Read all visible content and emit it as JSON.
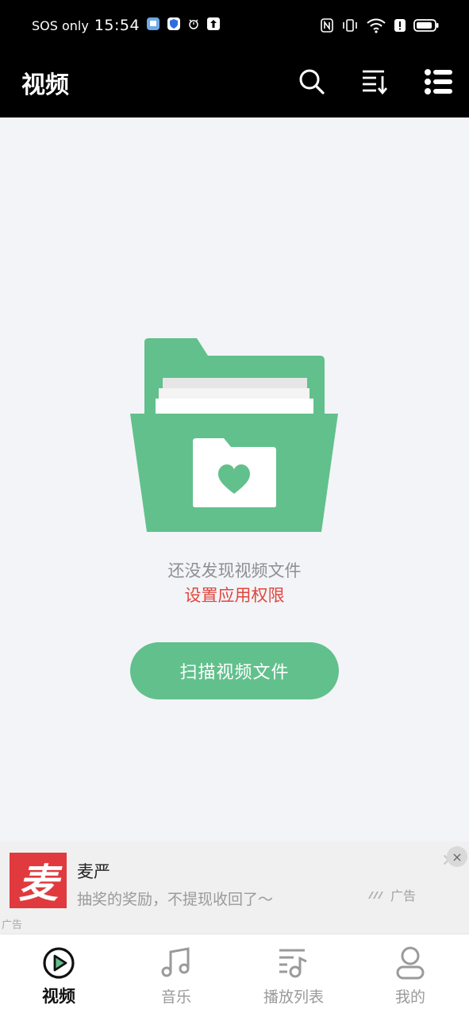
{
  "status_bar": {
    "carrier": "SOS only",
    "time": "15:54"
  },
  "header": {
    "title": "视频",
    "icons": [
      "search-icon",
      "sort-icon",
      "menu-list-icon"
    ]
  },
  "empty_state": {
    "message": "还没发现视频文件",
    "permission_link": "设置应用权限",
    "scan_button": "扫描视频文件",
    "illustration_color": "#62c08c"
  },
  "ad": {
    "logo_text": "麦",
    "title": "麦严",
    "description": "抽奖的奖励，不提现收回了～",
    "source_label": "广告",
    "corner_label": "广告",
    "close_icon": "×"
  },
  "bottom_nav": {
    "items": [
      {
        "label": "视频",
        "icon": "video-play-icon",
        "active": true
      },
      {
        "label": "音乐",
        "icon": "music-note-icon",
        "active": false
      },
      {
        "label": "播放列表",
        "icon": "playlist-icon",
        "active": false
      },
      {
        "label": "我的",
        "icon": "profile-icon",
        "active": false
      }
    ]
  },
  "colors": {
    "accent": "#62c08c",
    "link": "#e0463d",
    "header_bg": "#000000"
  }
}
